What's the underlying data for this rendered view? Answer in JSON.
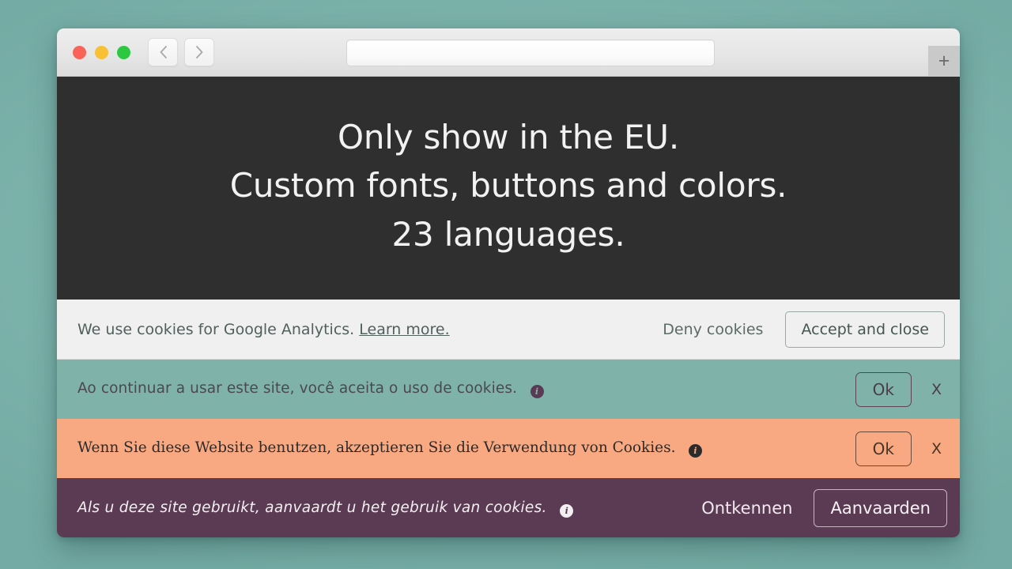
{
  "browser": {
    "traffic_lights": [
      "close",
      "minimize",
      "maximize"
    ],
    "back_label": "‹",
    "forward_label": "›",
    "url_value": "",
    "url_placeholder": "",
    "new_tab_label": "+"
  },
  "hero": {
    "lines": [
      "Only show in the EU.",
      "Custom fonts, buttons and colors.",
      "23 languages."
    ]
  },
  "banners": [
    {
      "id": "analytics",
      "message": "We use cookies for Google Analytics.",
      "link_label": "Learn more.",
      "deny_label": "Deny cookies",
      "accept_label": "Accept and close",
      "background": "#f0f0f0",
      "text_color": "#50605d"
    },
    {
      "id": "portuguese",
      "message": "Ao continuar a usar este site, você aceita o uso de cookies.",
      "info_icon": "info-icon",
      "ok_label": "Ok",
      "close_label": "X",
      "background": "#7fb3a9",
      "text_color": "#4c4751"
    },
    {
      "id": "german",
      "message": "Wenn Sie diese Website benutzen, akzeptieren Sie die Verwendung von Cookies.",
      "info_icon": "info-icon",
      "ok_label": "Ok",
      "close_label": "X",
      "background": "#f8a982",
      "text_color": "#2b2b2b"
    },
    {
      "id": "dutch",
      "message": "Als u deze site gebruikt, aanvaardt u het gebruik van cookies.",
      "info_icon": "info-icon",
      "deny_label": "Ontkennen",
      "accept_label": "Aanvaarden",
      "background": "#5b3b53",
      "text_color": "#f4f0f2"
    }
  ],
  "theme": {
    "page_background": "#7fb8b0",
    "hero_background": "#2f2f2f"
  }
}
